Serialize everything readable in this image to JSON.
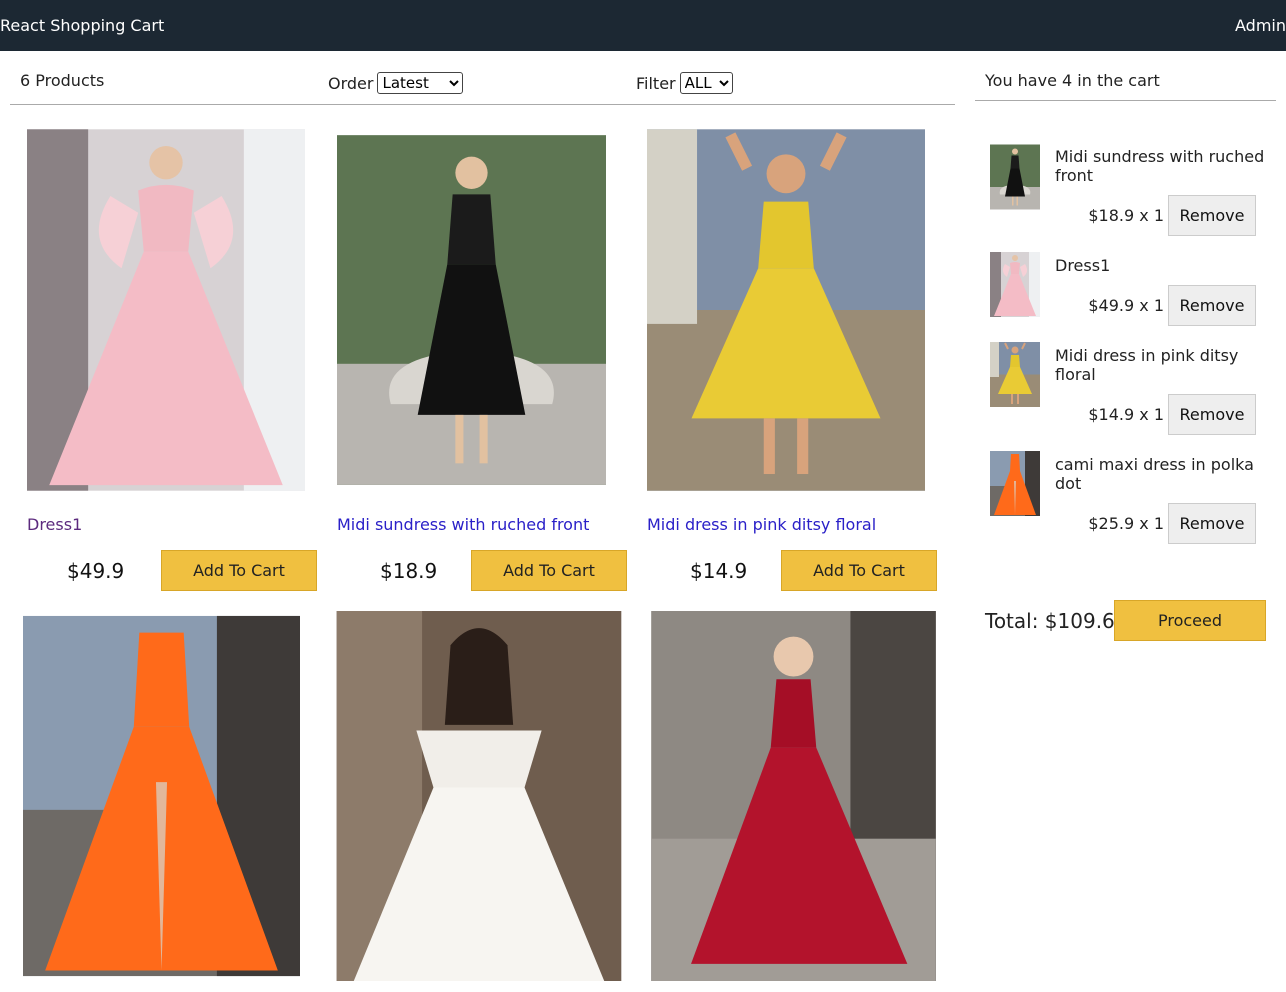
{
  "header": {
    "brand": "React Shopping Cart",
    "admin_link": "Admin"
  },
  "filter_bar": {
    "count_label": "6 Products",
    "order_label": "Order",
    "order_selected": "Latest",
    "filter_label": "Filter",
    "filter_selected": "ALL"
  },
  "products": [
    {
      "title": "Dress1",
      "price": "$49.9",
      "button": "Add To Cart"
    },
    {
      "title": "Midi sundress with ruched front",
      "price": "$18.9",
      "button": "Add To Cart"
    },
    {
      "title": "Midi dress in pink ditsy floral",
      "price": "$14.9",
      "button": "Add To Cart"
    },
    {
      "title": "",
      "price": "",
      "button": ""
    },
    {
      "title": "",
      "price": "",
      "button": ""
    },
    {
      "title": "",
      "price": "",
      "button": ""
    }
  ],
  "cart": {
    "heading": "You have 4 in the cart",
    "items": [
      {
        "title": "Midi sundress with ruched front",
        "qty": "$18.9 x 1",
        "button": "Remove"
      },
      {
        "title": "Dress1",
        "qty": "$49.9 x 1",
        "button": "Remove"
      },
      {
        "title": "Midi dress in pink ditsy floral",
        "qty": "$14.9 x 1",
        "button": "Remove"
      },
      {
        "title": "cami maxi dress in polka dot",
        "qty": "$25.9 x 1",
        "button": "Remove"
      }
    ],
    "total": "Total: $109.6",
    "proceed": "Proceed"
  },
  "colors": {
    "header_bg": "#1c2833",
    "accent_button": "#f0c040",
    "link": "#2a20c8",
    "visited_link": "#5c2a7e"
  }
}
